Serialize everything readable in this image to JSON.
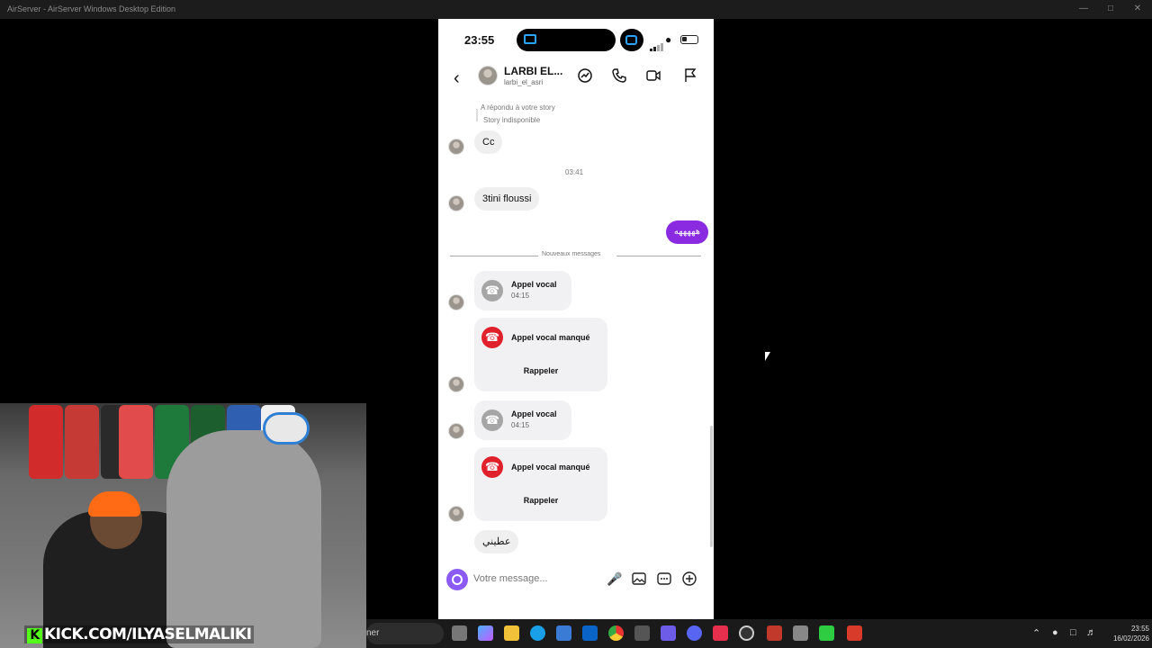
{
  "window": {
    "title": "AirServer - AirServer Windows Desktop Edition",
    "minimize_icon": "minimize-icon",
    "maximize_icon": "maximize-icon",
    "close_icon": "close-icon"
  },
  "phone": {
    "status": {
      "time": "23:55",
      "battery_level": 0.3
    },
    "header": {
      "name": "LARBI EL...",
      "username": "larbi_el_asri",
      "icons": [
        "back-icon",
        "trend-icon",
        "phone-icon",
        "video-icon",
        "flag-icon"
      ]
    },
    "chat": {
      "reply_note": "A répondu à votre story",
      "story_unavailable": "Story indisponible",
      "msg_cc": "Cc",
      "time_marker": "03:41",
      "msg_flouss": "3tini floussi",
      "my_msg": "هههههه",
      "new_messages": "Nouveaux messages",
      "calls": [
        {
          "type": "voice",
          "title": "Appel vocal",
          "duration": "04:15"
        },
        {
          "type": "missed",
          "title": "Appel vocal manqué",
          "action": "Rappeler"
        },
        {
          "type": "voice",
          "title": "Appel vocal",
          "duration": "04:15"
        },
        {
          "type": "missed",
          "title": "Appel vocal manqué",
          "action": "Rappeler"
        }
      ],
      "last_msg": "عطيني"
    },
    "composer": {
      "placeholder": "Votre message...",
      "icons": [
        "camera-icon",
        "microphone-icon",
        "gallery-icon",
        "sticker-icon",
        "plus-icon"
      ]
    }
  },
  "overlay": {
    "kick": "KICK.COM/ILYASELMALIKI"
  },
  "taskbar": {
    "search_text": "ner",
    "clock_time": "23:55",
    "clock_date": "16/02/2026",
    "app_icons": [
      "task-view-icon",
      "copilot-icon",
      "folder-icon",
      "edge-icon",
      "store-icon",
      "outlook-icon",
      "chrome-icon",
      "capcut-icon",
      "gamepad-icon",
      "discord-icon",
      "adobe-icon",
      "obs-icon",
      "news-icon",
      "app-icon",
      "play-icon",
      "airserver-icon"
    ],
    "accent_colors": {
      "instagram_purple": "#8a2be2",
      "missed_red": "#e0212b",
      "kick_green": "#53fc18"
    }
  }
}
